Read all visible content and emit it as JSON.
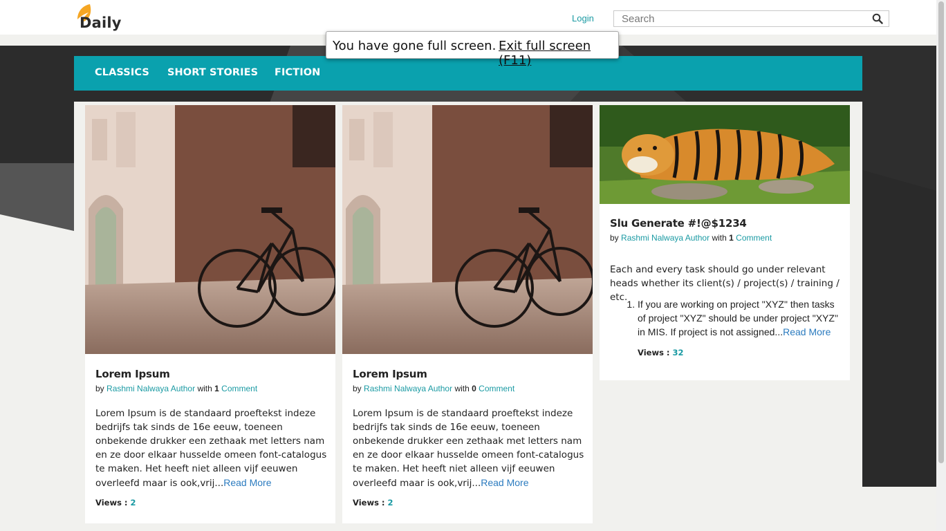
{
  "header": {
    "logo_text": "Daily",
    "login_label": "Login",
    "search_placeholder": "Search"
  },
  "fullscreen_notice": {
    "message": "You have gone full screen.",
    "exit_label": "Exit full screen (F11)"
  },
  "nav": {
    "items": [
      {
        "label": "CLASSICS"
      },
      {
        "label": "SHORT STORIES"
      },
      {
        "label": "FICTION"
      }
    ]
  },
  "posts": [
    {
      "title": "Lorem Ipsum",
      "by": "by",
      "author": "Rashmi Nalwaya Author",
      "with": "with",
      "comment_count": "1",
      "comment_label": "Comment",
      "excerpt": "Lorem Ipsum is de standaard proeftekst indeze bedrijfs tak sinds de 16e eeuw, toeneen onbekende drukker een zethaak met letters nam en ze door elkaar husselde omeen font-catalogus te maken. Het heeft niet alleen vijf eeuwen overleefd maar is ook,vrij...",
      "read_more": "Read More",
      "views_label": "Views :",
      "views": "2"
    },
    {
      "title": "Lorem Ipsum",
      "by": "by",
      "author": "Rashmi Nalwaya Author",
      "with": "with",
      "comment_count": "0",
      "comment_label": "Comment",
      "excerpt": "Lorem Ipsum is de standaard proeftekst indeze bedrijfs tak sinds de 16e eeuw, toeneen onbekende drukker een zethaak met letters nam en ze door elkaar husselde omeen font-catalogus te maken. Het heeft niet alleen vijf eeuwen overleefd maar is ook,vrij...",
      "read_more": "Read More",
      "views_label": "Views :",
      "views": "2"
    },
    {
      "title": "Slu Generate #!@$1234",
      "by": "by",
      "author": "Rashmi Nalwaya Author",
      "with": "with",
      "comment_count": "1",
      "comment_label": "Comment",
      "excerpt": "Each and every task should go under relevant heads whether its client(s) / project(s) / training / etc.",
      "list_item": "If you are working on project \"XYZ\" then tasks of project \"XYZ\" should be under project \"XYZ\" in MIS. If project is not assigned...",
      "read_more": "Read More",
      "views_label": "Views :",
      "views": "32"
    }
  ],
  "colors": {
    "nav_teal": "#0aa1ae",
    "link_teal": "#1a9aa3",
    "read_more_blue": "#2b7bbf",
    "logo_orange": "#f5a623"
  }
}
